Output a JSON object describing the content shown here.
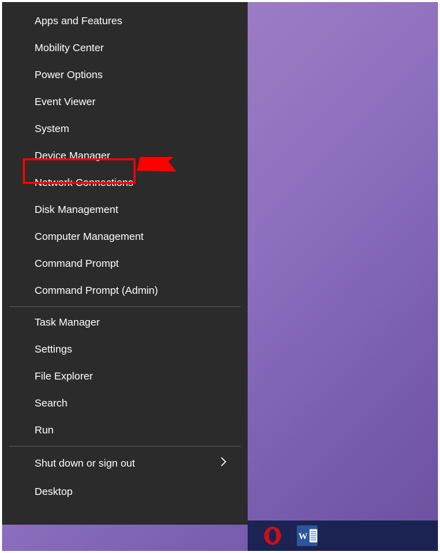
{
  "menu": {
    "groups": [
      {
        "items": [
          {
            "label": "Apps and Features",
            "id": "apps-features"
          },
          {
            "label": "Mobility Center",
            "id": "mobility-center"
          },
          {
            "label": "Power Options",
            "id": "power-options"
          },
          {
            "label": "Event Viewer",
            "id": "event-viewer"
          },
          {
            "label": "System",
            "id": "system"
          },
          {
            "label": "Device Manager",
            "id": "device-manager",
            "highlighted": true
          },
          {
            "label": "Network Connections",
            "id": "network-connections"
          },
          {
            "label": "Disk Management",
            "id": "disk-management"
          },
          {
            "label": "Computer Management",
            "id": "computer-management"
          },
          {
            "label": "Command Prompt",
            "id": "command-prompt"
          },
          {
            "label": "Command Prompt (Admin)",
            "id": "command-prompt-admin"
          }
        ]
      },
      {
        "items": [
          {
            "label": "Task Manager",
            "id": "task-manager"
          },
          {
            "label": "Settings",
            "id": "settings"
          },
          {
            "label": "File Explorer",
            "id": "file-explorer"
          },
          {
            "label": "Search",
            "id": "search"
          },
          {
            "label": "Run",
            "id": "run"
          }
        ]
      },
      {
        "items": [
          {
            "label": "Shut down or sign out",
            "id": "shutdown",
            "hasSubmenu": true
          },
          {
            "label": "Desktop",
            "id": "desktop"
          }
        ]
      }
    ]
  },
  "taskbar": {
    "icons": [
      {
        "name": "opera",
        "label": "Opera"
      },
      {
        "name": "word",
        "label": "W"
      }
    ]
  },
  "annotation": {
    "highlightColor": "#ff0000",
    "arrowColor": "#ff0000"
  }
}
